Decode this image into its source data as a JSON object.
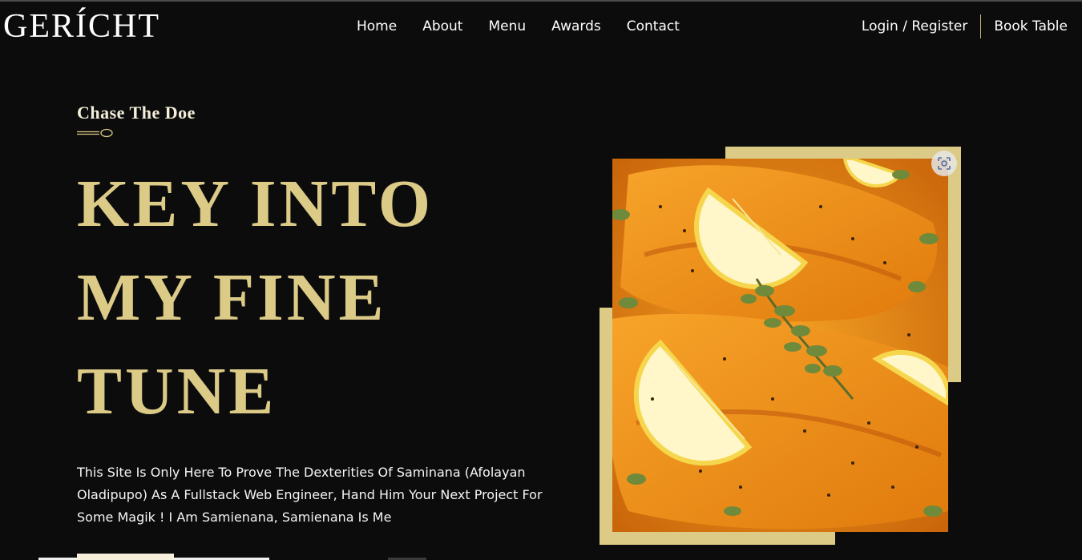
{
  "brand": {
    "logo": "GERÍCHT"
  },
  "nav": {
    "links": [
      "Home",
      "About",
      "Menu",
      "Awards",
      "Contact"
    ],
    "login": "Login / Register",
    "book": "Book Table"
  },
  "hero": {
    "subtitle": "Chase The Doe",
    "headline": [
      "KEY INTO",
      "MY FINE",
      "TUNE"
    ],
    "description": "This Site Is Only Here To Prove The Dexterities Of Saminana (Afolayan Oladipupo) As A Fullstack Web Engineer, Hand Him Your Next Project For Some Magik ! I Am Samienana, Samienana Is Me"
  },
  "icons": {
    "spoon": "spoon-icon",
    "lens": "visual-search-icon"
  },
  "colors": {
    "background": "#0c0c0c",
    "gold": "#dcca87",
    "cream": "#f5efdb",
    "food_orange": "#e88a14"
  }
}
